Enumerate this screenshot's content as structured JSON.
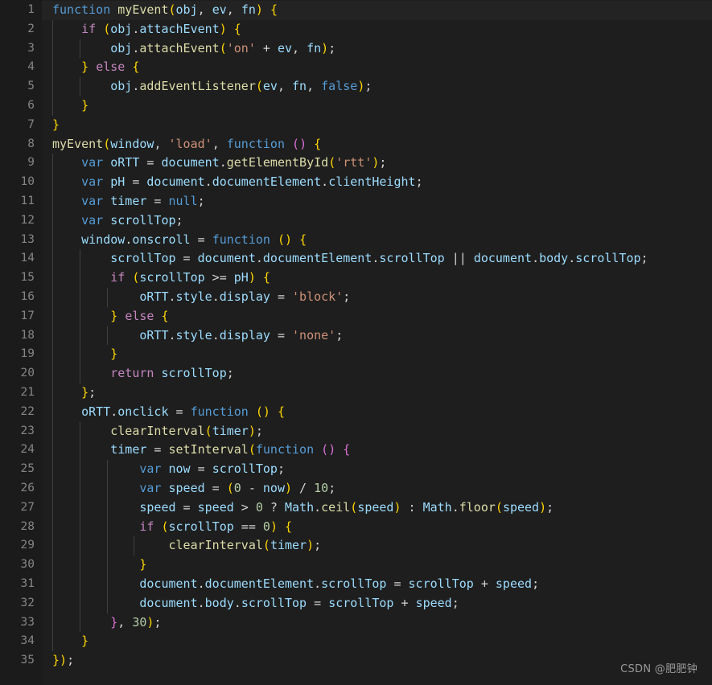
{
  "editor": {
    "background_color": "#1e1e1e",
    "gutter_color": "#1b1b1b",
    "current_line_color": "#232323",
    "line_number_color": "#858585",
    "default_text_color": "#d4d4d4",
    "language": "javascript",
    "total_lines": 35,
    "first_line_number": 1,
    "last_line_number": 35
  },
  "palette": {
    "keyword": "#569cd6",
    "control": "#c586c0",
    "function": "#dcdcaa",
    "variable": "#9cdcfe",
    "string": "#ce9178",
    "number": "#b5cea8",
    "punctuation": "#d4d4d4",
    "bracket_yellow": "#ffd700",
    "bracket_purple": "#da70d6",
    "bracket_blue": "#179fff"
  },
  "line_numbers": [
    "1",
    "2",
    "3",
    "4",
    "5",
    "6",
    "7",
    "8",
    "9",
    "10",
    "11",
    "12",
    "13",
    "14",
    "15",
    "16",
    "17",
    "18",
    "19",
    "20",
    "21",
    "22",
    "23",
    "24",
    "25",
    "26",
    "27",
    "28",
    "29",
    "30",
    "31",
    "32",
    "33",
    "34",
    "35"
  ],
  "code_lines": [
    "function myEvent(obj, ev, fn) {",
    "    if (obj.attachEvent) {",
    "        obj.attachEvent('on' + ev, fn);",
    "    } else {",
    "        obj.addEventListener(ev, fn, false);",
    "    }",
    "}",
    "myEvent(window, 'load', function () {",
    "    var oRTT = document.getElementById('rtt');",
    "    var pH = document.documentElement.clientHeight;",
    "    var timer = null;",
    "    var scrollTop;",
    "    window.onscroll = function () {",
    "        scrollTop = document.documentElement.scrollTop || document.body.scrollTop;",
    "        if (scrollTop >= pH) {",
    "            oRTT.style.display = 'block';",
    "        } else {",
    "            oRTT.style.display = 'none';",
    "        }",
    "        return scrollTop;",
    "    };",
    "    oRTT.onclick = function () {",
    "        clearInterval(timer);",
    "        timer = setInterval(function () {",
    "            var now = scrollTop;",
    "            var speed = (0 - now) / 10;",
    "            speed = speed > 0 ? Math.ceil(speed) : Math.floor(speed);",
    "            if (scrollTop == 0) {",
    "                clearInterval(timer);",
    "            }",
    "            document.documentElement.scrollTop = scrollTop + speed;",
    "            document.body.scrollTop = scrollTop + speed;",
    "        }, 30);",
    "    }",
    "});"
  ],
  "tokens": [
    [
      [
        "function ",
        "kw"
      ],
      [
        "myEvent",
        "fn"
      ],
      [
        "(",
        "br0"
      ],
      [
        "obj",
        "var"
      ],
      [
        ", ",
        "punc"
      ],
      [
        "ev",
        "var"
      ],
      [
        ", ",
        "punc"
      ],
      [
        "fn",
        "var"
      ],
      [
        ")",
        "br0"
      ],
      [
        " ",
        "punc"
      ],
      [
        "{",
        "br0"
      ]
    ],
    [
      [
        "    ",
        "punc"
      ],
      [
        "if",
        "ctrl"
      ],
      [
        " ",
        "punc"
      ],
      [
        "(",
        "br0"
      ],
      [
        "obj",
        "var"
      ],
      [
        ".",
        "punc"
      ],
      [
        "attachEvent",
        "var"
      ],
      [
        ")",
        "br0"
      ],
      [
        " ",
        "punc"
      ],
      [
        "{",
        "br0"
      ]
    ],
    [
      [
        "        ",
        "punc"
      ],
      [
        "obj",
        "var"
      ],
      [
        ".",
        "punc"
      ],
      [
        "attachEvent",
        "fn"
      ],
      [
        "(",
        "br0"
      ],
      [
        "'on'",
        "str"
      ],
      [
        " + ",
        "punc"
      ],
      [
        "ev",
        "var"
      ],
      [
        ", ",
        "punc"
      ],
      [
        "fn",
        "var"
      ],
      [
        ")",
        "br0"
      ],
      [
        ";",
        "punc"
      ]
    ],
    [
      [
        "    ",
        "punc"
      ],
      [
        "}",
        "br0"
      ],
      [
        " ",
        "punc"
      ],
      [
        "else",
        "ctrl"
      ],
      [
        " ",
        "punc"
      ],
      [
        "{",
        "br0"
      ]
    ],
    [
      [
        "        ",
        "punc"
      ],
      [
        "obj",
        "var"
      ],
      [
        ".",
        "punc"
      ],
      [
        "addEventListener",
        "fn"
      ],
      [
        "(",
        "br0"
      ],
      [
        "ev",
        "var"
      ],
      [
        ", ",
        "punc"
      ],
      [
        "fn",
        "var"
      ],
      [
        ", ",
        "punc"
      ],
      [
        "false",
        "kw"
      ],
      [
        ")",
        "br0"
      ],
      [
        ";",
        "punc"
      ]
    ],
    [
      [
        "    ",
        "punc"
      ],
      [
        "}",
        "br0"
      ]
    ],
    [
      [
        "}",
        "br0"
      ]
    ],
    [
      [
        "myEvent",
        "fn"
      ],
      [
        "(",
        "br0"
      ],
      [
        "window",
        "var"
      ],
      [
        ", ",
        "punc"
      ],
      [
        "'load'",
        "str"
      ],
      [
        ", ",
        "punc"
      ],
      [
        "function",
        "kw"
      ],
      [
        " ",
        "punc"
      ],
      [
        "(",
        "br1"
      ],
      [
        ")",
        "br1"
      ],
      [
        " ",
        "punc"
      ],
      [
        "{",
        "br0"
      ]
    ],
    [
      [
        "    ",
        "punc"
      ],
      [
        "var",
        "kw"
      ],
      [
        " ",
        "punc"
      ],
      [
        "oRTT",
        "var"
      ],
      [
        " = ",
        "punc"
      ],
      [
        "document",
        "var"
      ],
      [
        ".",
        "punc"
      ],
      [
        "getElementById",
        "fn"
      ],
      [
        "(",
        "br0"
      ],
      [
        "'rtt'",
        "str"
      ],
      [
        ")",
        "br0"
      ],
      [
        ";",
        "punc"
      ]
    ],
    [
      [
        "    ",
        "punc"
      ],
      [
        "var",
        "kw"
      ],
      [
        " ",
        "punc"
      ],
      [
        "pH",
        "var"
      ],
      [
        " = ",
        "punc"
      ],
      [
        "document",
        "var"
      ],
      [
        ".",
        "punc"
      ],
      [
        "documentElement",
        "var"
      ],
      [
        ".",
        "punc"
      ],
      [
        "clientHeight",
        "var"
      ],
      [
        ";",
        "punc"
      ]
    ],
    [
      [
        "    ",
        "punc"
      ],
      [
        "var",
        "kw"
      ],
      [
        " ",
        "punc"
      ],
      [
        "timer",
        "var"
      ],
      [
        " = ",
        "punc"
      ],
      [
        "null",
        "kw"
      ],
      [
        ";",
        "punc"
      ]
    ],
    [
      [
        "    ",
        "punc"
      ],
      [
        "var",
        "kw"
      ],
      [
        " ",
        "punc"
      ],
      [
        "scrollTop",
        "var"
      ],
      [
        ";",
        "punc"
      ]
    ],
    [
      [
        "    ",
        "punc"
      ],
      [
        "window",
        "var"
      ],
      [
        ".",
        "punc"
      ],
      [
        "onscroll",
        "var"
      ],
      [
        " = ",
        "punc"
      ],
      [
        "function",
        "kw"
      ],
      [
        " ",
        "punc"
      ],
      [
        "(",
        "br0"
      ],
      [
        ")",
        "br0"
      ],
      [
        " ",
        "punc"
      ],
      [
        "{",
        "br0"
      ]
    ],
    [
      [
        "        ",
        "punc"
      ],
      [
        "scrollTop",
        "var"
      ],
      [
        " = ",
        "punc"
      ],
      [
        "document",
        "var"
      ],
      [
        ".",
        "punc"
      ],
      [
        "documentElement",
        "var"
      ],
      [
        ".",
        "punc"
      ],
      [
        "scrollTop",
        "var"
      ],
      [
        " || ",
        "punc"
      ],
      [
        "document",
        "var"
      ],
      [
        ".",
        "punc"
      ],
      [
        "body",
        "var"
      ],
      [
        ".",
        "punc"
      ],
      [
        "scrollTop",
        "var"
      ],
      [
        ";",
        "punc"
      ]
    ],
    [
      [
        "        ",
        "punc"
      ],
      [
        "if",
        "ctrl"
      ],
      [
        " ",
        "punc"
      ],
      [
        "(",
        "br0"
      ],
      [
        "scrollTop",
        "var"
      ],
      [
        " >= ",
        "punc"
      ],
      [
        "pH",
        "var"
      ],
      [
        ")",
        "br0"
      ],
      [
        " ",
        "punc"
      ],
      [
        "{",
        "br0"
      ]
    ],
    [
      [
        "            ",
        "punc"
      ],
      [
        "oRTT",
        "var"
      ],
      [
        ".",
        "punc"
      ],
      [
        "style",
        "var"
      ],
      [
        ".",
        "punc"
      ],
      [
        "display",
        "var"
      ],
      [
        " = ",
        "punc"
      ],
      [
        "'block'",
        "str"
      ],
      [
        ";",
        "punc"
      ]
    ],
    [
      [
        "        ",
        "punc"
      ],
      [
        "}",
        "br0"
      ],
      [
        " ",
        "punc"
      ],
      [
        "else",
        "ctrl"
      ],
      [
        " ",
        "punc"
      ],
      [
        "{",
        "br0"
      ]
    ],
    [
      [
        "            ",
        "punc"
      ],
      [
        "oRTT",
        "var"
      ],
      [
        ".",
        "punc"
      ],
      [
        "style",
        "var"
      ],
      [
        ".",
        "punc"
      ],
      [
        "display",
        "var"
      ],
      [
        " = ",
        "punc"
      ],
      [
        "'none'",
        "str"
      ],
      [
        ";",
        "punc"
      ]
    ],
    [
      [
        "        ",
        "punc"
      ],
      [
        "}",
        "br0"
      ]
    ],
    [
      [
        "        ",
        "punc"
      ],
      [
        "return",
        "ctrl"
      ],
      [
        " ",
        "punc"
      ],
      [
        "scrollTop",
        "var"
      ],
      [
        ";",
        "punc"
      ]
    ],
    [
      [
        "    ",
        "punc"
      ],
      [
        "}",
        "br0"
      ],
      [
        ";",
        "punc"
      ]
    ],
    [
      [
        "    ",
        "punc"
      ],
      [
        "oRTT",
        "var"
      ],
      [
        ".",
        "punc"
      ],
      [
        "onclick",
        "var"
      ],
      [
        " = ",
        "punc"
      ],
      [
        "function",
        "kw"
      ],
      [
        " ",
        "punc"
      ],
      [
        "(",
        "br0"
      ],
      [
        ")",
        "br0"
      ],
      [
        " ",
        "punc"
      ],
      [
        "{",
        "br0"
      ]
    ],
    [
      [
        "        ",
        "punc"
      ],
      [
        "clearInterval",
        "fn"
      ],
      [
        "(",
        "br0"
      ],
      [
        "timer",
        "var"
      ],
      [
        ")",
        "br0"
      ],
      [
        ";",
        "punc"
      ]
    ],
    [
      [
        "        ",
        "punc"
      ],
      [
        "timer",
        "var"
      ],
      [
        " = ",
        "punc"
      ],
      [
        "setInterval",
        "fn"
      ],
      [
        "(",
        "br0"
      ],
      [
        "function",
        "kw"
      ],
      [
        " ",
        "punc"
      ],
      [
        "(",
        "br1"
      ],
      [
        ")",
        "br1"
      ],
      [
        " ",
        "punc"
      ],
      [
        "{",
        "br1"
      ]
    ],
    [
      [
        "            ",
        "punc"
      ],
      [
        "var",
        "kw"
      ],
      [
        " ",
        "punc"
      ],
      [
        "now",
        "var"
      ],
      [
        " = ",
        "punc"
      ],
      [
        "scrollTop",
        "var"
      ],
      [
        ";",
        "punc"
      ]
    ],
    [
      [
        "            ",
        "punc"
      ],
      [
        "var",
        "kw"
      ],
      [
        " ",
        "punc"
      ],
      [
        "speed",
        "var"
      ],
      [
        " = ",
        "punc"
      ],
      [
        "(",
        "br0"
      ],
      [
        "0",
        "num"
      ],
      [
        " - ",
        "punc"
      ],
      [
        "now",
        "var"
      ],
      [
        ")",
        "br0"
      ],
      [
        " / ",
        "punc"
      ],
      [
        "10",
        "num"
      ],
      [
        ";",
        "punc"
      ]
    ],
    [
      [
        "            ",
        "punc"
      ],
      [
        "speed",
        "var"
      ],
      [
        " = ",
        "punc"
      ],
      [
        "speed",
        "var"
      ],
      [
        " > ",
        "punc"
      ],
      [
        "0",
        "num"
      ],
      [
        " ? ",
        "punc"
      ],
      [
        "Math",
        "var"
      ],
      [
        ".",
        "punc"
      ],
      [
        "ceil",
        "fn"
      ],
      [
        "(",
        "br0"
      ],
      [
        "speed",
        "var"
      ],
      [
        ")",
        "br0"
      ],
      [
        " : ",
        "punc"
      ],
      [
        "Math",
        "var"
      ],
      [
        ".",
        "punc"
      ],
      [
        "floor",
        "fn"
      ],
      [
        "(",
        "br0"
      ],
      [
        "speed",
        "var"
      ],
      [
        ")",
        "br0"
      ],
      [
        ";",
        "punc"
      ]
    ],
    [
      [
        "            ",
        "punc"
      ],
      [
        "if",
        "ctrl"
      ],
      [
        " ",
        "punc"
      ],
      [
        "(",
        "br0"
      ],
      [
        "scrollTop",
        "var"
      ],
      [
        " == ",
        "punc"
      ],
      [
        "0",
        "num"
      ],
      [
        ")",
        "br0"
      ],
      [
        " ",
        "punc"
      ],
      [
        "{",
        "br0"
      ]
    ],
    [
      [
        "                ",
        "punc"
      ],
      [
        "clearInterval",
        "fn"
      ],
      [
        "(",
        "br0"
      ],
      [
        "timer",
        "var"
      ],
      [
        ")",
        "br0"
      ],
      [
        ";",
        "punc"
      ]
    ],
    [
      [
        "            ",
        "punc"
      ],
      [
        "}",
        "br0"
      ]
    ],
    [
      [
        "            ",
        "punc"
      ],
      [
        "document",
        "var"
      ],
      [
        ".",
        "punc"
      ],
      [
        "documentElement",
        "var"
      ],
      [
        ".",
        "punc"
      ],
      [
        "scrollTop",
        "var"
      ],
      [
        " = ",
        "punc"
      ],
      [
        "scrollTop",
        "var"
      ],
      [
        " + ",
        "punc"
      ],
      [
        "speed",
        "var"
      ],
      [
        ";",
        "punc"
      ]
    ],
    [
      [
        "            ",
        "punc"
      ],
      [
        "document",
        "var"
      ],
      [
        ".",
        "punc"
      ],
      [
        "body",
        "var"
      ],
      [
        ".",
        "punc"
      ],
      [
        "scrollTop",
        "var"
      ],
      [
        " = ",
        "punc"
      ],
      [
        "scrollTop",
        "var"
      ],
      [
        " + ",
        "punc"
      ],
      [
        "speed",
        "var"
      ],
      [
        ";",
        "punc"
      ]
    ],
    [
      [
        "        ",
        "punc"
      ],
      [
        "}",
        "br1"
      ],
      [
        ", ",
        "punc"
      ],
      [
        "30",
        "num"
      ],
      [
        ")",
        "br0"
      ],
      [
        ";",
        "punc"
      ]
    ],
    [
      [
        "    ",
        "punc"
      ],
      [
        "}",
        "br0"
      ]
    ],
    [
      [
        "}",
        "br0"
      ],
      [
        ")",
        "br0"
      ],
      [
        ";",
        "punc"
      ]
    ]
  ],
  "indent_guides": [
    {
      "line_start": 2,
      "line_end": 6,
      "level": 1
    },
    {
      "line_start": 3,
      "line_end": 3,
      "level": 2
    },
    {
      "line_start": 5,
      "line_end": 5,
      "level": 2
    },
    {
      "line_start": 9,
      "line_end": 34,
      "level": 1
    },
    {
      "line_start": 14,
      "line_end": 20,
      "level": 2
    },
    {
      "line_start": 16,
      "line_end": 16,
      "level": 3
    },
    {
      "line_start": 18,
      "line_end": 18,
      "level": 3
    },
    {
      "line_start": 23,
      "line_end": 33,
      "level": 2
    },
    {
      "line_start": 25,
      "line_end": 32,
      "level": 3
    },
    {
      "line_start": 29,
      "line_end": 29,
      "level": 4
    }
  ],
  "watermark": {
    "text": "CSDN @肥肥钟"
  }
}
